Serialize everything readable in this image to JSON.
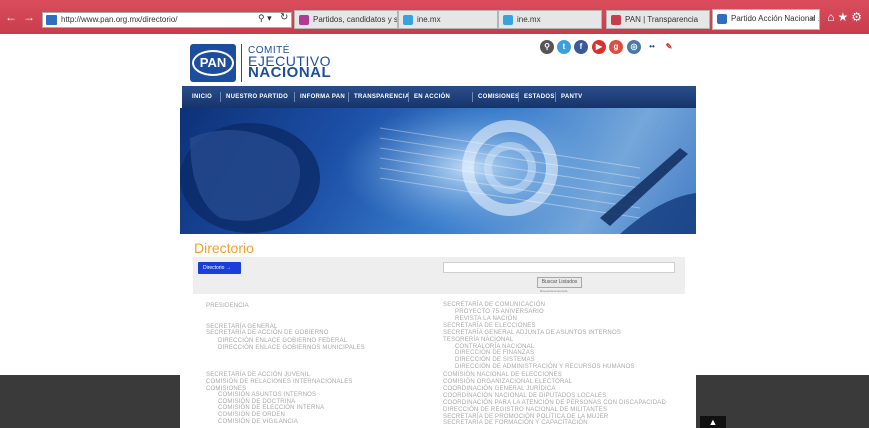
{
  "browser": {
    "url": "http://www.pan.org.mx/directorio/",
    "tabs": [
      {
        "label": "Partidos, candidatos y sus ca...",
        "color": "#b03a92"
      },
      {
        "label": "ine.mx",
        "color": "#3aa0e0"
      },
      {
        "label": "PAN | Transparencia",
        "color": "#c83c4c"
      },
      {
        "label": "Partido Acción Nacional ...",
        "color": "#2e6fc2"
      }
    ]
  },
  "header": {
    "logo_mark": "PAN",
    "logo_line1": "COMITÉ",
    "logo_line2": "EJECUTIVO",
    "logo_line3": "NACIONAL"
  },
  "social_icons": [
    {
      "name": "search-icon",
      "glyph": "⚲",
      "color": "#555555"
    },
    {
      "name": "twitter-icon",
      "glyph": "t",
      "color": "#3aa0e0"
    },
    {
      "name": "facebook-icon",
      "glyph": "f",
      "color": "#3b5998"
    },
    {
      "name": "youtube-icon",
      "glyph": "▶",
      "color": "#d9302c"
    },
    {
      "name": "googleplus-icon",
      "glyph": "g",
      "color": "#dc4e41"
    },
    {
      "name": "instagram-icon",
      "glyph": "◎",
      "color": "#4a78a8"
    },
    {
      "name": "flickr-icon",
      "glyph": "••",
      "color": "#ffffff"
    },
    {
      "name": "pan-icon",
      "glyph": "✎",
      "color": "#ffffff"
    }
  ],
  "nav": [
    "INICIO",
    "NUESTRO PARTIDO",
    "INFORMA PAN",
    "TRANSPARENCIA",
    "EN ACCIÓN",
    "COMISIONES",
    "ESTADOS",
    "PANTV"
  ],
  "main": {
    "title": "Directorio",
    "directory_button": "Directorio →",
    "search_button": "Buscar Listados",
    "search_hint": "Búsqueda Avanzada"
  },
  "directory_left": [
    {
      "text": "PRESIDENCIA",
      "indent": 0
    },
    {
      "text": "SECRETARÍA GENERAL",
      "indent": 0
    },
    {
      "text": "SECRETARÍA DE ACCIÓN DE GOBIERNO",
      "indent": 0
    },
    {
      "text": "DIRECCIÓN ENLACE GOBIERNO FEDERAL",
      "indent": 1
    },
    {
      "text": "DIRECCIÓN ENLACE GOBIERNOS MUNICIPALES",
      "indent": 1
    },
    {
      "text": "SECRETARÍA DE ACCIÓN JUVENIL",
      "indent": 0
    },
    {
      "text": "COMISIÓN DE RELACIONES INTERNACIONALES",
      "indent": 0
    },
    {
      "text": "COMISIONES",
      "indent": 0
    },
    {
      "text": "COMISIÓN ASUNTOS INTERNOS",
      "indent": 1
    },
    {
      "text": "COMISIÓN DE DOCTRINA",
      "indent": 1
    },
    {
      "text": "COMISIÓN DE ELECCIÓN INTERNA",
      "indent": 1
    },
    {
      "text": "COMISIÓN DE ORDEN",
      "indent": 1
    },
    {
      "text": "COMISIÓN DE VIGILANCIA",
      "indent": 1
    }
  ],
  "directory_right": [
    {
      "text": "SECRETARÍA DE COMUNICACIÓN",
      "indent": 0
    },
    {
      "text": "PROYECTO 75 ANIVERSARIO",
      "indent": 1
    },
    {
      "text": "REVISTA LA NACIÓN",
      "indent": 1
    },
    {
      "text": "SECRETARÍA DE ELECCIONES",
      "indent": 0
    },
    {
      "text": "SECRETARÍA GENERAL ADJUNTA DE ASUNTOS INTERNOS",
      "indent": 0
    },
    {
      "text": "TESORERÍA NACIONAL",
      "indent": 0
    },
    {
      "text": "CONTRALORÍA NACIONAL",
      "indent": 1
    },
    {
      "text": "DIRECCIÓN DE FINANZAS",
      "indent": 1
    },
    {
      "text": "DIRECCIÓN DE SISTEMAS",
      "indent": 1
    },
    {
      "text": "DIRECCIÓN DE ADMINISTRACIÓN Y RECURSOS HUMANOS",
      "indent": 1
    },
    {
      "text": "COMISIÓN NACIONAL DE ELECCIONES",
      "indent": 0
    },
    {
      "text": "COMISIÓN ORGANIZACIONAL ELECTORAL",
      "indent": 0
    },
    {
      "text": "COORDINACIÓN GENERAL JURÍDICA",
      "indent": 0
    },
    {
      "text": "COORDINACIÓN NACIONAL DE DIPUTADOS LOCALES",
      "indent": 0
    },
    {
      "text": "COORDINACIÓN PARA LA ATENCIÓN DE PERSONAS CON DISCAPACIDAD",
      "indent": 0
    },
    {
      "text": "DIRECCIÓN DE REGISTRO NACIONAL DE MILITANTES",
      "indent": 0
    },
    {
      "text": "SECRETARÍA DE PROMOCIÓN POLÍTICA DE LA MUJER",
      "indent": 0
    },
    {
      "text": "SECRETARÍA DE FORMACIÓN Y CAPACITACIÓN",
      "indent": 0
    }
  ]
}
